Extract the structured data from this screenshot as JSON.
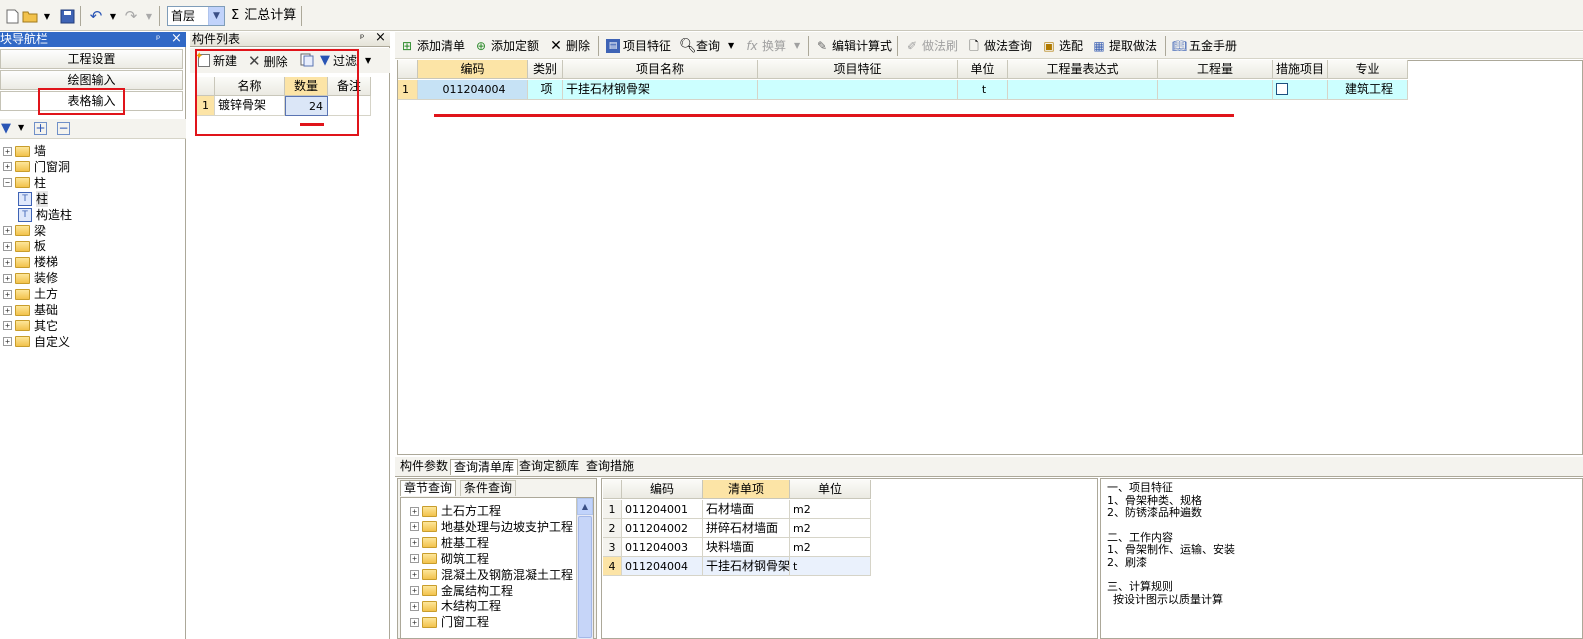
{
  "toolbar": {
    "floor_select": "首层",
    "sum_label": "汇总计算",
    "sum_symbol": "Σ"
  },
  "nav_panel": {
    "title": "模块导航栏",
    "pin": "ᵖ",
    "close": "×",
    "buttons": [
      "工程设置",
      "绘图输入",
      "表格输入"
    ],
    "tree": [
      {
        "label": "墙",
        "expanded": false
      },
      {
        "label": "门窗洞",
        "expanded": false
      },
      {
        "label": "柱",
        "expanded": true
      },
      {
        "label": "柱",
        "child": true
      },
      {
        "label": "构造柱",
        "child": true
      },
      {
        "label": "梁",
        "expanded": false
      },
      {
        "label": "板",
        "expanded": false
      },
      {
        "label": "楼梯",
        "expanded": false
      },
      {
        "label": "装修",
        "expanded": false
      },
      {
        "label": "土方",
        "expanded": false
      },
      {
        "label": "基础",
        "expanded": false
      },
      {
        "label": "其它",
        "expanded": false
      },
      {
        "label": "自定义",
        "expanded": false
      }
    ]
  },
  "component_panel": {
    "title": "构件列表",
    "new_label": "新建",
    "delete_label": "删除",
    "filter_label": "过滤",
    "columns": [
      "名称",
      "数量",
      "备注"
    ],
    "rows": [
      {
        "index": "1",
        "name": "镀锌骨架",
        "qty": "24",
        "note": ""
      }
    ]
  },
  "main_toolbar": {
    "add_list": "添加清单",
    "add_quota": "添加定额",
    "delete": "删除",
    "item_feature": "项目特征",
    "query": "查询",
    "convert": "换算",
    "edit_formula": "编辑计算式",
    "method_brush": "做法刷",
    "method_query": "做法查询",
    "select_match": "选配",
    "extract_method": "提取做法",
    "hardware_manual": "五金手册"
  },
  "main_grid": {
    "columns": [
      "编码",
      "类别",
      "项目名称",
      "项目特征",
      "单位",
      "工程量表达式",
      "工程量",
      "措施项目",
      "专业"
    ],
    "rows": [
      {
        "index": "1",
        "code": "011204004",
        "type": "项",
        "name": "干挂石材钢骨架",
        "feature": "",
        "unit": "t",
        "expr": "",
        "qty": "",
        "measure": false,
        "major": "建筑工程"
      }
    ]
  },
  "bottom_tabs": [
    "构件参数",
    "查询清单库",
    "查询定额库",
    "查询措施"
  ],
  "lib_tabs": [
    "章节查询",
    "条件查询"
  ],
  "chapters": [
    "土石方工程",
    "地基处理与边坡支护工程",
    "桩基工程",
    "砌筑工程",
    "混凝土及钢筋混凝土工程",
    "金属结构工程",
    "木结构工程",
    "门窗工程"
  ],
  "lib_grid": {
    "columns": [
      "编码",
      "清单项",
      "单位"
    ],
    "rows": [
      {
        "index": "1",
        "code": "011204001",
        "name": "石材墙面",
        "unit": "m2"
      },
      {
        "index": "2",
        "code": "011204002",
        "name": "拼碎石材墙面",
        "unit": "m2"
      },
      {
        "index": "3",
        "code": "011204003",
        "name": "块料墙面",
        "unit": "m2"
      },
      {
        "index": "4",
        "code": "011204004",
        "name": "干挂石材钢骨架",
        "unit": "t"
      }
    ]
  },
  "description": {
    "s1_title": "一、项目特征",
    "s1_l1": "1、骨架种类、规格",
    "s1_l2": "2、防锈漆品种遍数",
    "s2_title": "二、工作内容",
    "s2_l1": "1、骨架制作、运输、安装",
    "s2_l2": "2、刷漆",
    "s3_title": "三、计算规则",
    "s3_l1": "按设计图示以质量计算"
  },
  "colors": {
    "highlight_header": "#fce4a6",
    "selected_row": "#ccffff",
    "title_blue": "#3169c6",
    "annotation_red": "#e0141a"
  }
}
